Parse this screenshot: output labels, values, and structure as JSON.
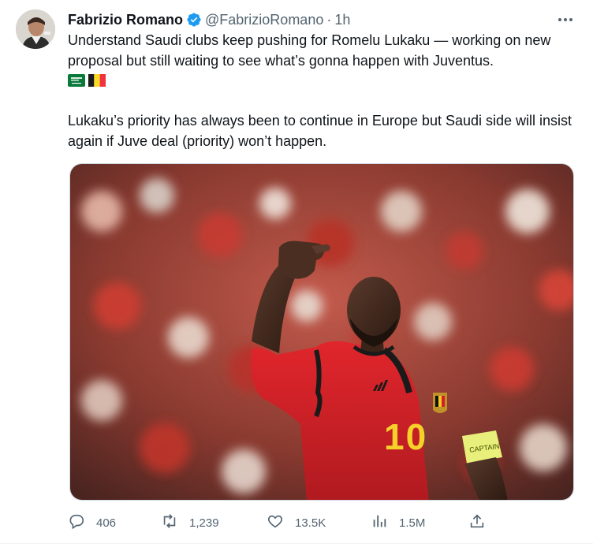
{
  "author": {
    "display_name": "Fabrizio Romano",
    "handle": "@FabrizioRomano",
    "separator": "·",
    "time": "1h"
  },
  "tweet": {
    "paragraph_1": "Understand Saudi clubs keep pushing for Romelu Lukaku — working on new proposal but still waiting to see what’s gonna happen with Juventus.",
    "paragraph_2": "Lukaku’s priority has always been to continue in Europe but Saudi side will insist again if Juve deal (priority) won’t happen.",
    "flags": [
      "saudi-arabia-flag",
      "belgium-flag"
    ]
  },
  "media": {
    "jersey_number": "10",
    "armband_text": "CAPTAIN"
  },
  "actions": {
    "replies": "406",
    "retweets": "1,239",
    "likes": "13.5K",
    "views": "1.5M"
  },
  "icons": {
    "verified": "verified-badge-icon",
    "more": "more-options-icon",
    "reply": "reply-icon",
    "retweet": "retweet-icon",
    "like": "heart-icon",
    "views": "views-icon",
    "share": "share-icon"
  },
  "colors": {
    "text_primary": "#0f1419",
    "text_secondary": "#536471",
    "verified_blue": "#1d9bf0",
    "jersey_red": "#d41f26",
    "jersey_number_yellow": "#f6d12a"
  }
}
